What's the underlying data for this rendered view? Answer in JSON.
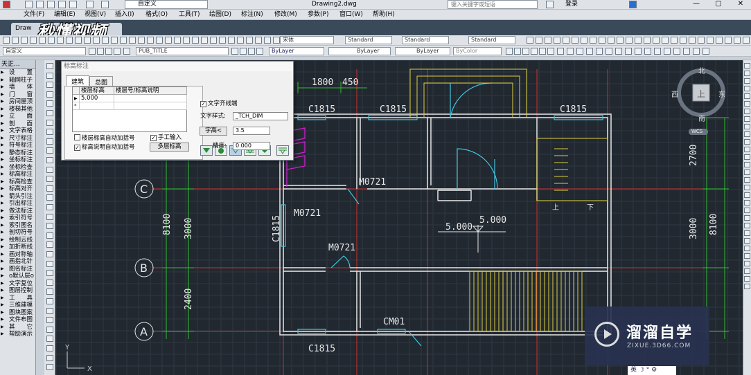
{
  "titlebar": {
    "workspace": "自定义",
    "document_title": "Drawing2.dwg",
    "search_placeholder": "键入关键字或短语",
    "login": "登录"
  },
  "menu": [
    "文件(F)",
    "编辑(E)",
    "视图(V)",
    "插入(I)",
    "格式(O)",
    "工具(T)",
    "绘图(D)",
    "标注(N)",
    "修改(M)",
    "参数(P)",
    "窗口(W)",
    "帮助(H)"
  ],
  "doc_tab": "Draw",
  "watermark_text": "秒懂视频",
  "toolbar": {
    "font_combo": "宋体",
    "style1": "Standard",
    "style2": "Standard",
    "style3": "Standard",
    "custom": "自定义",
    "layer": "PUB_TITLE",
    "color": "ByLayer",
    "linetype": "ByLayer",
    "lineweight": "ByLayer",
    "plotstyle": "ByColor"
  },
  "left_panel": {
    "title": "天正...",
    "items": [
      "设　　置",
      "轴网柱子",
      "墙　　体",
      "门　　窗",
      "房间屋顶",
      "楼梯其他",
      "立　　面",
      "剖　　面",
      "文字表格",
      "尺寸标注",
      "符号标注",
      "静态标注",
      "坐标标注",
      "坐标检查",
      "标高标注",
      "标高检查",
      "标高对齐",
      "箭头引注",
      "引出标注",
      "做法标注",
      "索引符号",
      "索引图名",
      "剖切符号",
      "绘制云线",
      "加折断线",
      "画对称轴",
      "画指北针",
      "图名标注",
      "o默认层o",
      "文字复位",
      "图层控制",
      "工　　具",
      "三维建模",
      "图块图案",
      "文件布图",
      "其　　它",
      "帮助演示"
    ]
  },
  "dialog": {
    "title": "标高标注",
    "tab_arch": "建筑",
    "tab_general": "总图",
    "col_level": "楼层标高",
    "col_desc": "楼层号/标高说明",
    "row_value": "5.000",
    "chk_auto_bracket": "楼层标高自动加括号",
    "chk_manual": "手工输入",
    "chk_desc_bracket": "标高说明自动加括号",
    "btn_multi": "多层标高",
    "chk_align": "文字齐线端",
    "label_style": "文字样式:",
    "style_value": "_TCH_DIM",
    "btn_height": "字高<",
    "height_value": "3.5",
    "label_precision": "精度:",
    "precision_value": "0.000"
  },
  "drawing": {
    "dims_top": [
      "1800",
      "450"
    ],
    "windows": [
      "C1815",
      "C1815",
      "C1815",
      "C1815"
    ],
    "doors": [
      "M0721",
      "M0721",
      "M0721"
    ],
    "cm": "CM01",
    "axes": [
      "C",
      "B",
      "A"
    ],
    "dims_left": [
      "8100",
      "3000",
      "2400"
    ],
    "dims_right": [
      "2700",
      "3000",
      "8100"
    ],
    "level_labels": [
      "5.000",
      "5.000"
    ],
    "stair_up": "上",
    "stair_down": "下",
    "ucs_y": "Y",
    "ucs_x": "X"
  },
  "compass": {
    "north": "北",
    "south": "南",
    "east": "东",
    "west": "西",
    "center": "上",
    "wcs": "WCS"
  },
  "logo": {
    "cn": "溜溜自学",
    "en": "ZIXUE.3D66.COM"
  },
  "ime": "英 ☽ ° ⚙"
}
